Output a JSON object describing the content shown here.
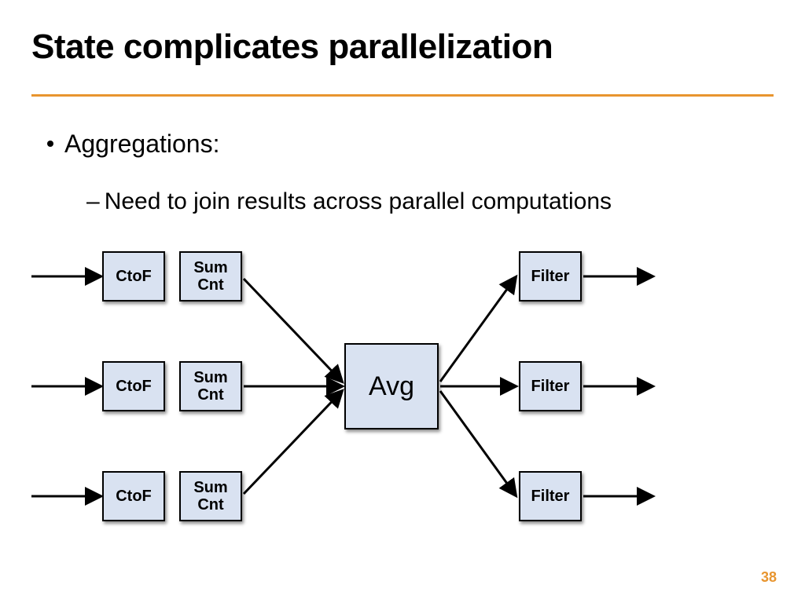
{
  "title": "State complicates parallelization",
  "bullets": {
    "b1": "Aggregations:",
    "b2": "Need to join results across parallel computations"
  },
  "diagram": {
    "rows": [
      {
        "ctof": "CtoF",
        "sumcnt": "Sum\nCnt",
        "filter": "Filter"
      },
      {
        "ctof": "CtoF",
        "sumcnt": "Sum\nCnt",
        "filter": "Filter"
      },
      {
        "ctof": "CtoF",
        "sumcnt": "Sum\nCnt",
        "filter": "Filter"
      }
    ],
    "center": "Avg"
  },
  "page": "38"
}
